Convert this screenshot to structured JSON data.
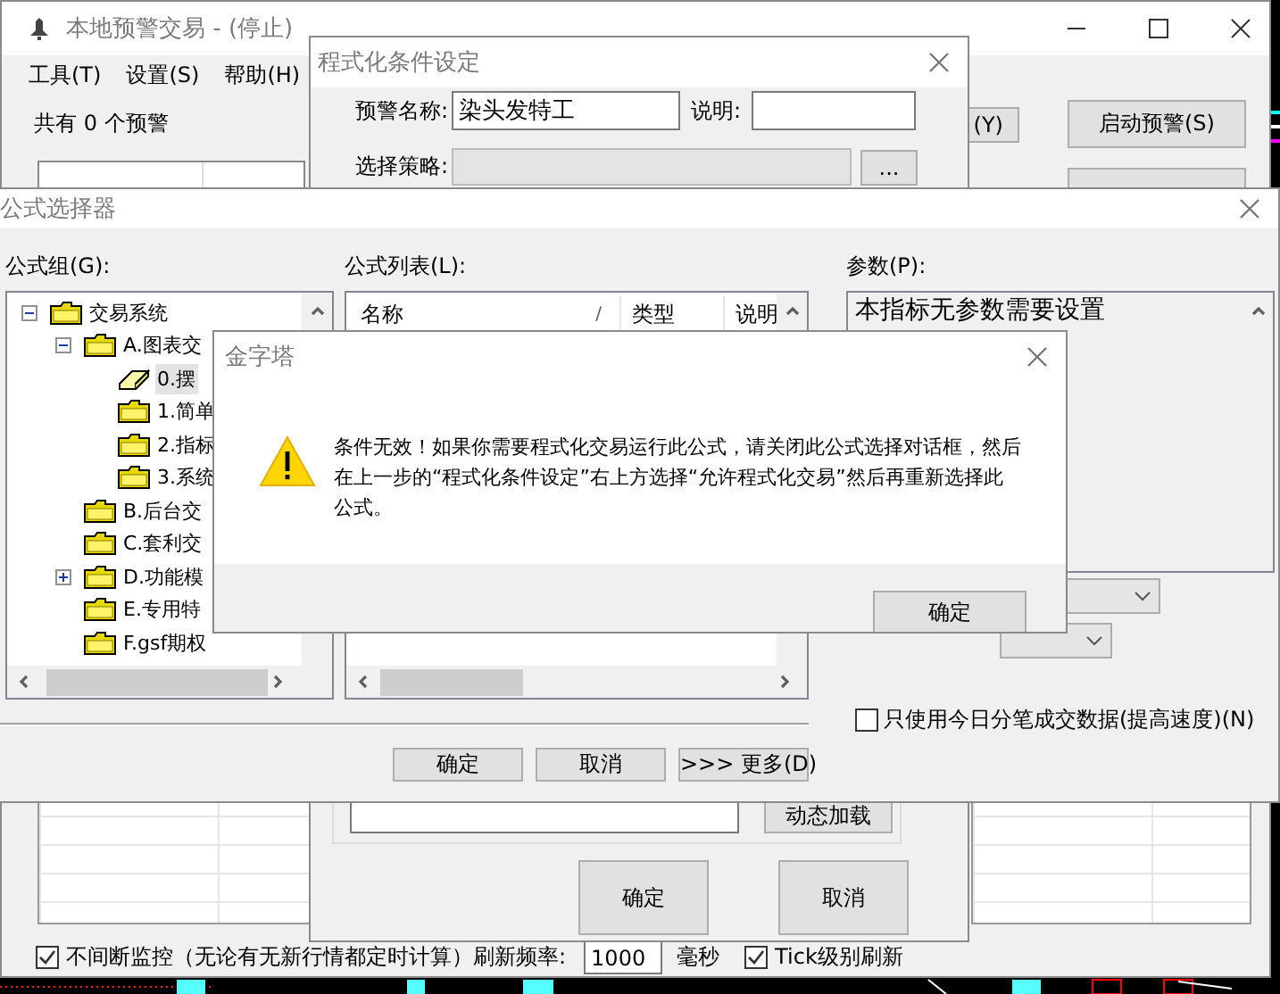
{
  "main_window": {
    "title": "本地预警交易 - (停止)",
    "menu": [
      "工具(T)",
      "设置(S)",
      "帮助(H)"
    ],
    "alert_count": "共有 0 个预警",
    "buttons": [
      "(Y)",
      "启动预警(S)"
    ],
    "monitor": {
      "continuous": {
        "label": "不间断监控（无论有无新行情都定时计算）刷新频率:",
        "checked": true
      },
      "refresh_rate": "1000",
      "unit": "毫秒",
      "tick": {
        "label": "Tick级别刷新",
        "checked": true
      }
    }
  },
  "condition_window": {
    "title": "程式化条件设定",
    "name_label": "预警名称:",
    "name_value": "染头发特工",
    "note_label": "说明:",
    "strategy_label": "选择策略:",
    "browse_button": "...",
    "load_button": "动态加载",
    "buttons": [
      "确定",
      "取消"
    ]
  },
  "formula_selector": {
    "title": "公式选择器",
    "group_label": "公式组(G):",
    "tree": [
      {
        "label": "交易系统",
        "kind": "group",
        "expanded": true,
        "selected": false,
        "children": [
          {
            "label": "A.图表交",
            "kind": "group",
            "expanded": true,
            "selected": false,
            "children": [
              {
                "label": "0.摆",
                "kind": "formula",
                "selected": true
              },
              {
                "label": "1.简单",
                "kind": "folder",
                "selected": false
              },
              {
                "label": "2.指标",
                "kind": "folder",
                "selected": false
              },
              {
                "label": "3.系统",
                "kind": "folder",
                "selected": false
              }
            ]
          },
          {
            "label": "B.后台交",
            "kind": "folder",
            "selected": false
          },
          {
            "label": "C.套利交",
            "kind": "folder",
            "selected": false
          },
          {
            "label": "D.功能模",
            "kind": "group",
            "expanded": false,
            "selected": false
          },
          {
            "label": "E.专用特",
            "kind": "folder",
            "selected": false
          },
          {
            "label": "F.gsf期权",
            "kind": "folder",
            "selected": false
          }
        ]
      }
    ],
    "list_label": "公式列表(L):",
    "list_columns": [
      {
        "label": "名称",
        "sort_mark": "/"
      },
      {
        "label": "类型"
      },
      {
        "label": "说明"
      }
    ],
    "param_label": "参数(P):",
    "param_text": "本指标无参数需要设置",
    "today_only": {
      "label": "只使用今日分笔成交数据(提高速度)(N)",
      "checked": false
    },
    "buttons": [
      "确定",
      "取消",
      ">>> 更多(D)"
    ]
  },
  "alert_dialog": {
    "title": "金字塔",
    "message": "条件无效！如果你需要程式化交易运行此公式，请关闭此公式选择对话框，然后在上一步的“程式化条件设定”右上方选择“允许程式化交易”然后再重新选择此公式。",
    "button": "确定"
  }
}
